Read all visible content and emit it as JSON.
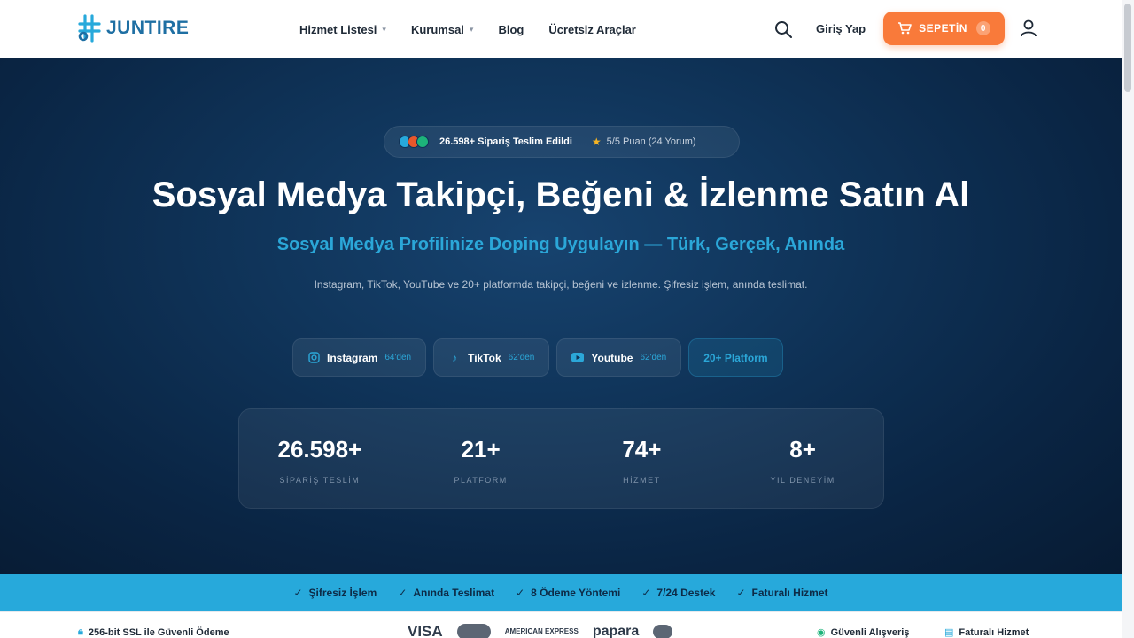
{
  "brand": {
    "name": "JUNTIRE",
    "color": "#1e6fa3"
  },
  "nav": [
    {
      "label": "Hizmet Listesi",
      "has_dropdown": true
    },
    {
      "label": "Kurumsal",
      "has_dropdown": true
    },
    {
      "label": "Blog",
      "has_dropdown": false
    },
    {
      "label": "Ücretsiz Araçlar",
      "has_dropdown": false
    }
  ],
  "header": {
    "search_icon": "search-icon",
    "login_label": "Giriş Yap",
    "cart_label": "SEPETİN",
    "cart_count": "0",
    "cart_color": "#f97a3a",
    "user_icon": "user-icon"
  },
  "hero": {
    "badge_orders": "26.598+ Sipariş Teslim Edildi",
    "badge_rating": "5/5 Puan (24 Yorum)",
    "title": "Sosyal Medya Takipçi, Beğeni & İzlenme Satın Al",
    "subtitle": "Sosyal Medya Profilinize Doping Uygulayın — Türk, Gerçek, Anında",
    "description": "Instagram, TikTok, YouTube ve 20+ platformda takipçi, beğeni ve izlenme. Şifresiz işlem, anında teslimat.",
    "accent_color": "#2ba7d8",
    "platforms": [
      {
        "icon": "instagram-icon",
        "name": "Instagram",
        "count": "64'den"
      },
      {
        "icon": "tiktok-icon",
        "name": "TikTok",
        "count": "62'den"
      },
      {
        "icon": "youtube-icon",
        "name": "Youtube",
        "count": "62'den"
      }
    ],
    "more_platforms": "20+ Platform"
  },
  "stats": [
    {
      "value": "26.598+",
      "label": "SİPARİŞ TESLİM"
    },
    {
      "value": "21+",
      "label": "PLATFORM"
    },
    {
      "value": "74+",
      "label": "HİZMET"
    },
    {
      "value": "8+",
      "label": "YIL DENEYİM"
    }
  ],
  "features": [
    "Şifresiz İşlem",
    "Anında Teslimat",
    "8 Ödeme Yöntemi",
    "7/24 Destek",
    "Faturalı Hizmet"
  ],
  "trust": {
    "ssl": "256-bit SSL ile Güvenli Ödeme",
    "payments": [
      "VISA",
      "AMERICAN EXPRESS",
      "papara"
    ],
    "secure_shopping": "Güvenli Alışveriş",
    "invoiced_service": "Faturalı Hizmet"
  }
}
